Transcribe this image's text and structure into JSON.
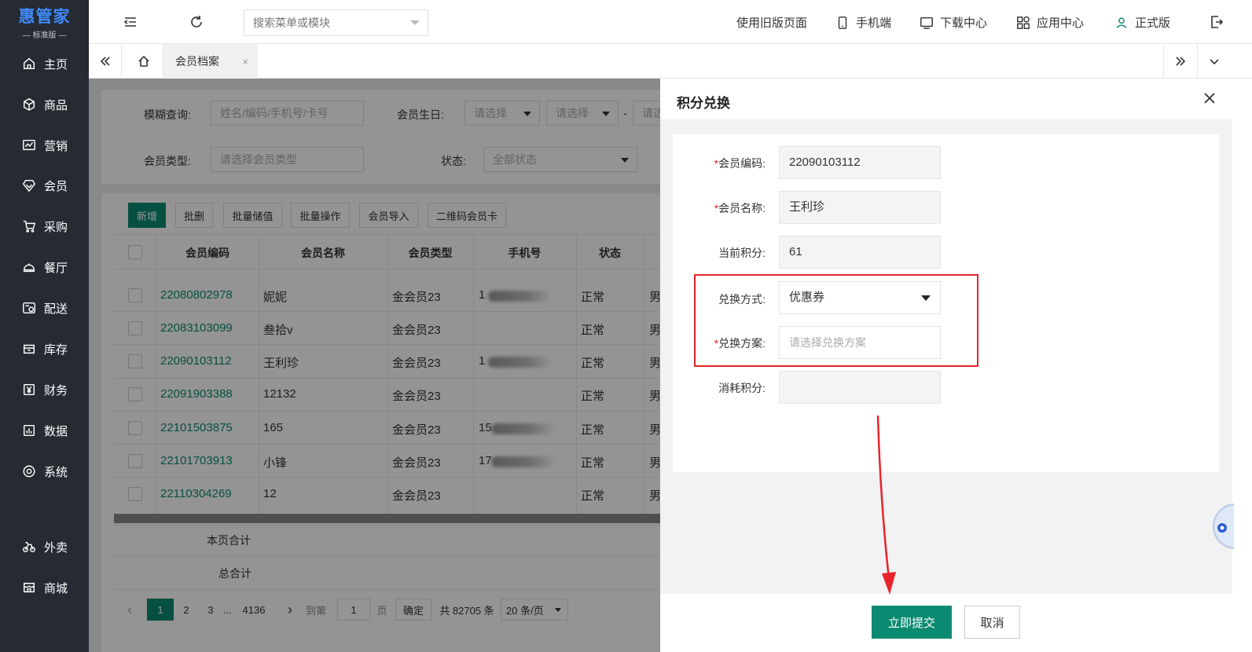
{
  "app": {
    "logo_title": "惠管家",
    "logo_sub": "— 标准版 —"
  },
  "sidebar": {
    "items": [
      {
        "label": "主页",
        "icon": "home-icon"
      },
      {
        "label": "商品",
        "icon": "cube-icon"
      },
      {
        "label": "营销",
        "icon": "chart-icon"
      },
      {
        "label": "会员",
        "icon": "diamond-icon"
      },
      {
        "label": "采购",
        "icon": "cart-icon"
      },
      {
        "label": "餐厅",
        "icon": "cloche-icon"
      },
      {
        "label": "配送",
        "icon": "delivery-icon"
      },
      {
        "label": "库存",
        "icon": "box-icon"
      },
      {
        "label": "财务",
        "icon": "yen-icon"
      },
      {
        "label": "数据",
        "icon": "bar-chart-icon"
      },
      {
        "label": "系统",
        "icon": "settings-icon"
      },
      {
        "label": "外卖",
        "icon": "bike-icon"
      },
      {
        "label": "商城",
        "icon": "store-icon"
      }
    ]
  },
  "header": {
    "search_placeholder": "搜索菜单或模块",
    "links": [
      {
        "label": "使用旧版页面"
      },
      {
        "label": "手机端",
        "icon": "phone-icon"
      },
      {
        "label": "下载中心",
        "icon": "download-icon"
      },
      {
        "label": "应用中心",
        "icon": "apps-icon"
      },
      {
        "label": "正式版",
        "icon": "user-icon"
      }
    ]
  },
  "tabs": {
    "active": "会员档案",
    "close": "×"
  },
  "filters": {
    "fuzzy_label": "模糊查询:",
    "fuzzy_placeholder": "姓名/编码/手机号/卡号",
    "birthday_label": "会员生日:",
    "birthday_ph1": "请选择",
    "birthday_ph2": "请选择",
    "birthday_sep": "-",
    "birthday_ph3": "请选",
    "type_label": "会员类型:",
    "type_placeholder": "请选择会员类型",
    "status_label": "状态:",
    "status_value": "全部状态"
  },
  "toolbar": [
    "新增",
    "批删",
    "批量储值",
    "批量操作",
    "会员导入",
    "二维码会员卡"
  ],
  "table": {
    "headers": [
      "会员编码",
      "会员名称",
      "会员类型",
      "手机号",
      "状态"
    ],
    "rows": [
      {
        "code": "22080802978",
        "name": "妮妮",
        "type": "金会员23",
        "phone": "1",
        "status": "正常",
        "gender": "男"
      },
      {
        "code": "22083103099",
        "name": "叁拾v",
        "type": "金会员23",
        "phone": "",
        "status": "正常",
        "gender": "男"
      },
      {
        "code": "22090103112",
        "name": "王利珍",
        "type": "金会员23",
        "phone": "1",
        "status": "正常",
        "gender": "男"
      },
      {
        "code": "22091903388",
        "name": "12132",
        "type": "金会员23",
        "phone": "",
        "status": "正常",
        "gender": "男"
      },
      {
        "code": "22101503875",
        "name": "165",
        "type": "金会员23",
        "phone": "15",
        "status": "正常",
        "gender": "男"
      },
      {
        "code": "22101703913",
        "name": "小锋",
        "type": "金会员23",
        "phone": "17",
        "status": "正常",
        "gender": "男"
      },
      {
        "code": "22110304269",
        "name": "12",
        "type": "金会员23",
        "phone": "",
        "status": "正常",
        "gender": "男"
      }
    ],
    "page_total_label": "本页合计",
    "grand_total_label": "总合计"
  },
  "pager": {
    "prev": "‹",
    "pages": [
      "1",
      "2",
      "3",
      "...",
      "4136"
    ],
    "next": "›",
    "goto_label": "到第",
    "goto_value": "1",
    "page_unit": "页",
    "confirm": "确定",
    "total": "共 82705 条",
    "page_size": "20 条/页"
  },
  "drawer": {
    "title": "积分兑换",
    "fields": [
      {
        "label": "会员编码:",
        "required": true,
        "value": "22090103112"
      },
      {
        "label": "会员名称:",
        "required": true,
        "value": "王利珍"
      },
      {
        "label": "当前积分:",
        "required": false,
        "value": "61"
      },
      {
        "label": "兑换方式:",
        "required": false,
        "value": "优惠券"
      },
      {
        "label": "兑换方案:",
        "required": true,
        "placeholder": "请选择兑换方案"
      },
      {
        "label": "消耗积分:",
        "required": false,
        "value": ""
      }
    ],
    "submit": "立即提交",
    "cancel": "取消"
  },
  "colors": {
    "primary": "#0b8a72",
    "sidebar": "#252a33",
    "logo": "#3f8cff",
    "annotation": "#e8232b"
  }
}
